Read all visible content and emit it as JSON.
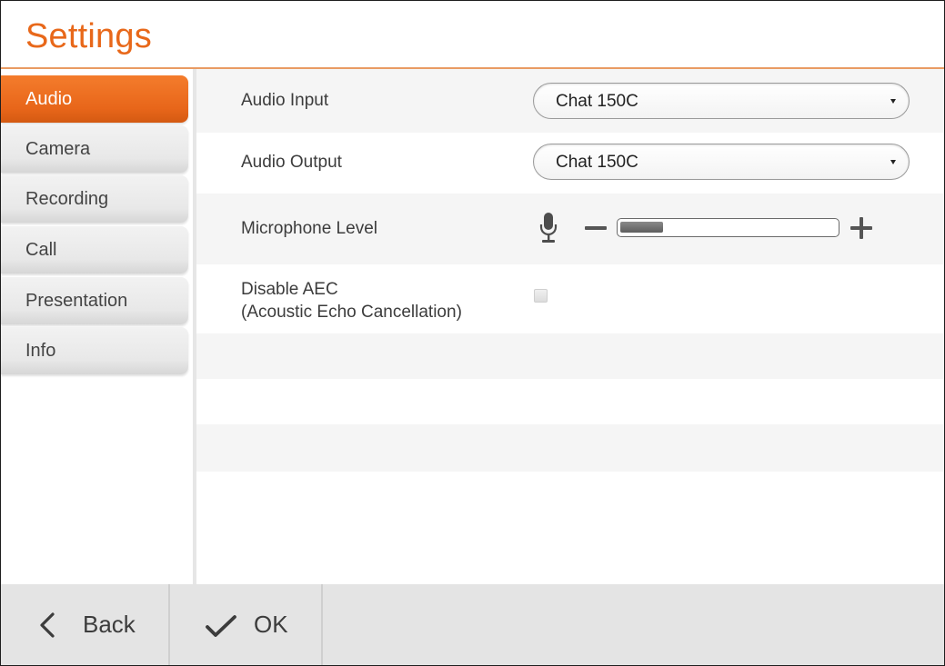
{
  "header": {
    "title": "Settings"
  },
  "sidebar": {
    "items": [
      {
        "label": "Audio",
        "active": true
      },
      {
        "label": "Camera",
        "active": false
      },
      {
        "label": "Recording",
        "active": false
      },
      {
        "label": "Call",
        "active": false
      },
      {
        "label": "Presentation",
        "active": false
      },
      {
        "label": "Info",
        "active": false
      }
    ]
  },
  "audio": {
    "input": {
      "label": "Audio Input",
      "value": "Chat 150C"
    },
    "output": {
      "label": "Audio Output",
      "value": "Chat 150C"
    },
    "microphone": {
      "label": "Microphone Level",
      "level_fraction": 0.2,
      "icon": "microphone-icon"
    },
    "aec": {
      "label_line1": "Disable AEC",
      "label_line2": "(Acoustic Echo Cancellation)",
      "checked": false
    }
  },
  "footer": {
    "back_label": "Back",
    "ok_label": "OK",
    "back_icon": "chevron-left-icon",
    "ok_icon": "checkmark-icon"
  },
  "colors": {
    "accent": "#e8681a",
    "header_rule": "#e99b63",
    "row_alt": "#f5f5f5",
    "footer_bg": "#e4e4e4"
  }
}
